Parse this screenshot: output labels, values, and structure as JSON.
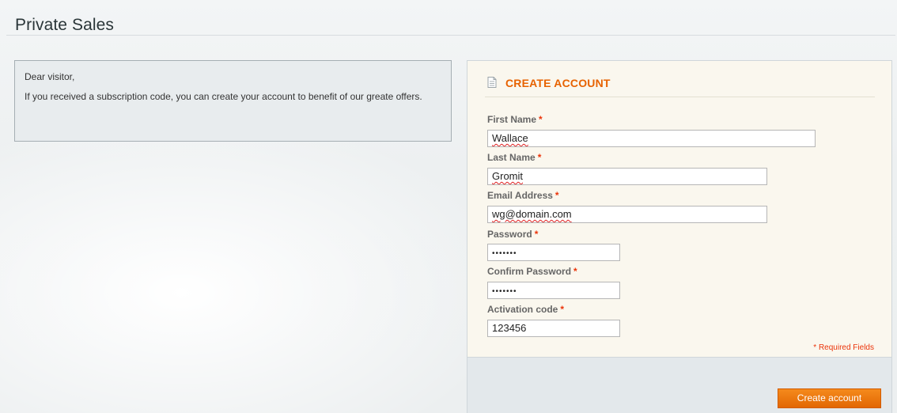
{
  "header": {
    "title": "Private Sales"
  },
  "notice": {
    "greeting": "Dear visitor,",
    "message": "If you received a subscription code, you can create your account to benefit of our greate offers."
  },
  "form": {
    "section_title": "CREATE ACCOUNT",
    "section_icon": "document-icon",
    "required_marker": "*",
    "fields": {
      "first_name": {
        "label": "First Name",
        "value": "Wallace"
      },
      "last_name": {
        "label": "Last Name",
        "value": "Gromit"
      },
      "email": {
        "label": "Email Address",
        "value": "wg@domain.com"
      },
      "password": {
        "label": "Password",
        "value": "•••••••"
      },
      "confirm_password": {
        "label": "Confirm Password",
        "value": "•••••••"
      },
      "activation_code": {
        "label": "Activation code",
        "value": "123456"
      }
    },
    "required_note": "* Required Fields",
    "submit_label": "Create account"
  },
  "colors": {
    "accent": "#e76200",
    "required": "#eb340a",
    "button": "#f07f13"
  }
}
